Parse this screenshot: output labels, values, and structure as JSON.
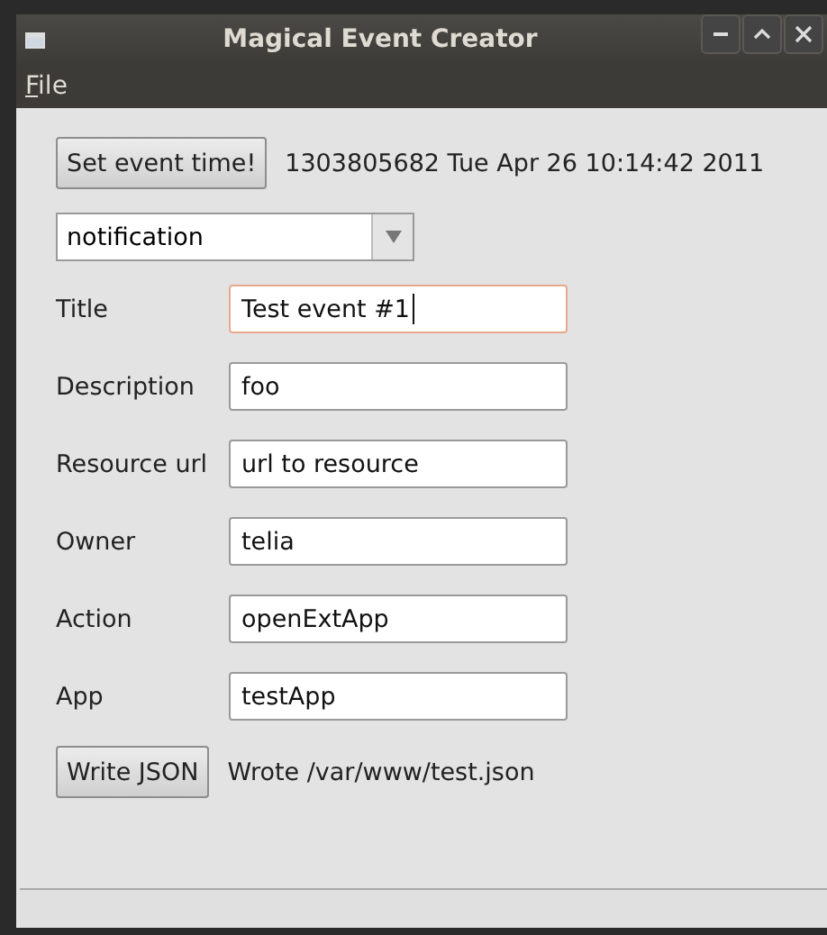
{
  "window": {
    "title": "Magical Event Creator"
  },
  "menu": [
    {
      "label": "File",
      "mnemonic": true
    }
  ],
  "event_time": {
    "button": "Set event time!",
    "value": "1303805682 Tue Apr 26 10:14:42 2011"
  },
  "type_combo": {
    "value": "notification"
  },
  "fields": [
    {
      "label": "Title",
      "value": "Test event #1",
      "focused": true
    },
    {
      "label": "Description",
      "value": "foo",
      "focused": false
    },
    {
      "label": "Resource url",
      "value": "url to resource",
      "focused": false
    },
    {
      "label": "Owner",
      "value": "telia",
      "focused": false
    },
    {
      "label": "Action",
      "value": "openExtApp",
      "focused": false
    },
    {
      "label": "App",
      "value": "testApp",
      "focused": false
    }
  ],
  "write": {
    "button": "Write JSON",
    "status": "Wrote /var/www/test.json"
  }
}
